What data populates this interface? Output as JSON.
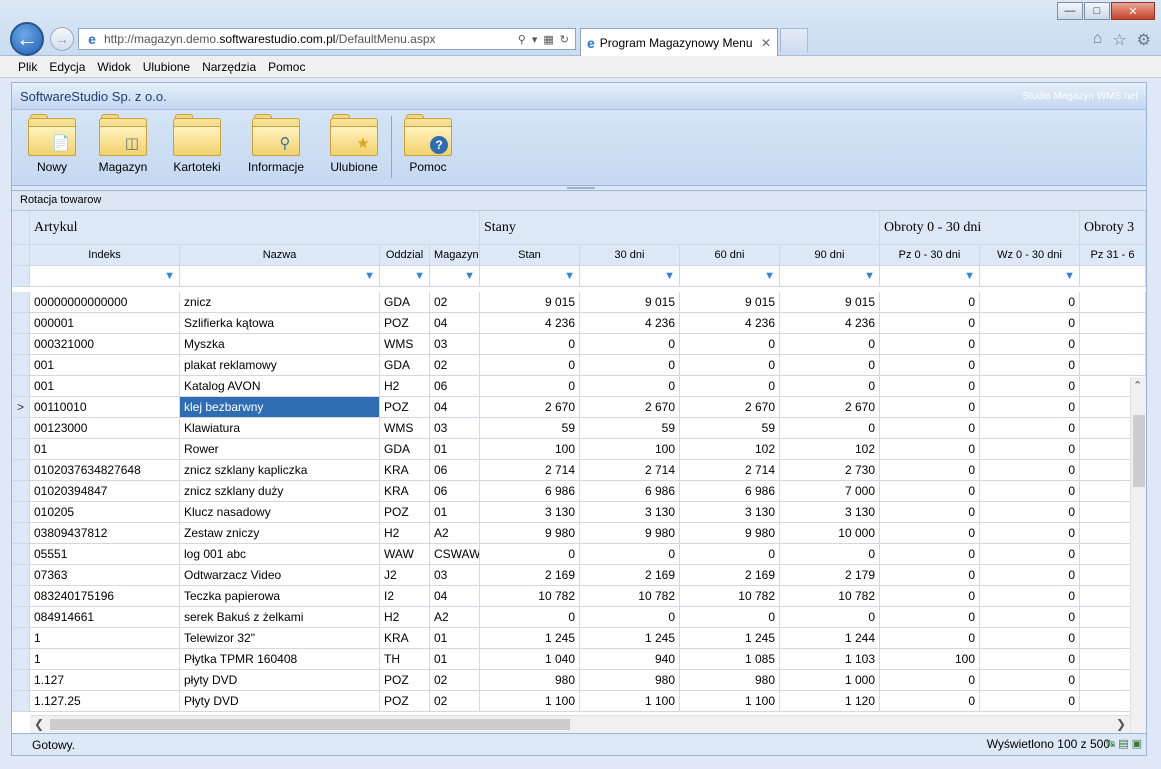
{
  "browser": {
    "url_prefix": "http://magazyn.demo.",
    "url_host": "softwarestudio.com.pl",
    "url_path": "/DefaultMenu.aspx",
    "tab_title": "Program Magazynowy Menu",
    "tab_close": "✕",
    "back": "←",
    "forward": "→"
  },
  "menu": [
    "Plik",
    "Edycja",
    "Widok",
    "Ulubione",
    "Narzędzia",
    "Pomoc"
  ],
  "app": {
    "company": "SoftwareStudio Sp. z o.o.",
    "product": "Studio Magazyn WMS.net",
    "toolbar": [
      {
        "label": "Nowy",
        "icon": "new-document-icon"
      },
      {
        "label": "Magazyn",
        "icon": "database-icon"
      },
      {
        "label": "Kartoteki",
        "icon": "folder-icon"
      },
      {
        "label": "Informacje",
        "icon": "search-icon"
      },
      {
        "label": "Ulubione",
        "icon": "star-icon"
      },
      {
        "label": "Pomoc",
        "icon": "help-icon"
      }
    ],
    "section_title": "Rotacja towarow"
  },
  "grid": {
    "bands": [
      "Artykul",
      "Stany",
      "Obroty 0 - 30 dni",
      "Obroty 3"
    ],
    "columns": [
      "Indeks",
      "Nazwa",
      "Oddzial",
      "Magazyn",
      "Stan",
      "30 dni",
      "60 dni",
      "90 dni",
      "Pz 0 - 30 dni",
      "Wz 0 - 30 dni",
      "Pz 31 - 6"
    ],
    "selected_marker": ">",
    "rows": [
      [
        "00000000000000",
        "znicz",
        "GDA",
        "02",
        "9 015",
        "9 015",
        "9 015",
        "9 015",
        "0",
        "0"
      ],
      [
        "000001",
        "Szlifierka kątowa",
        "POZ",
        "04",
        "4 236",
        "4 236",
        "4 236",
        "4 236",
        "0",
        "0"
      ],
      [
        "000321000",
        "Myszka",
        "WMS",
        "03",
        "0",
        "0",
        "0",
        "0",
        "0",
        "0"
      ],
      [
        "001",
        "plakat reklamowy",
        "GDA",
        "02",
        "0",
        "0",
        "0",
        "0",
        "0",
        "0"
      ],
      [
        "001",
        "Katalog AVON",
        "H2",
        "06",
        "0",
        "0",
        "0",
        "0",
        "0",
        "0"
      ],
      [
        "00110010",
        "klej bezbarwny",
        "POZ",
        "04",
        "2 670",
        "2 670",
        "2 670",
        "2 670",
        "0",
        "0"
      ],
      [
        "00123000",
        "Klawiatura",
        "WMS",
        "03",
        "59",
        "59",
        "59",
        "0",
        "0",
        "0"
      ],
      [
        "01",
        "Rower",
        "GDA",
        "01",
        "100",
        "100",
        "102",
        "102",
        "0",
        "0"
      ],
      [
        "0102037634827648",
        "znicz szklany kapliczka",
        "KRA",
        "06",
        "2 714",
        "2 714",
        "2 714",
        "2 730",
        "0",
        "0"
      ],
      [
        "01020394847",
        "znicz szklany duży",
        "KRA",
        "06",
        "6 986",
        "6 986",
        "6 986",
        "7 000",
        "0",
        "0"
      ],
      [
        "010205",
        "Klucz nasadowy",
        "POZ",
        "01",
        "3 130",
        "3 130",
        "3 130",
        "3 130",
        "0",
        "0"
      ],
      [
        "03809437812",
        "Zestaw zniczy",
        "H2",
        "A2",
        "9 980",
        "9 980",
        "9 980",
        "10 000",
        "0",
        "0"
      ],
      [
        "05551",
        "log 001 abc",
        "WAW",
        "CSWAW",
        "0",
        "0",
        "0",
        "0",
        "0",
        "0"
      ],
      [
        "07363",
        "Odtwarzacz Video",
        "J2",
        "03",
        "2 169",
        "2 169",
        "2 169",
        "2 179",
        "0",
        "0"
      ],
      [
        "083240175196",
        "Teczka papierowa",
        "I2",
        "04",
        "10 782",
        "10 782",
        "10 782",
        "10 782",
        "0",
        "0"
      ],
      [
        "084914661",
        "serek Bakuś z żelkami",
        "H2",
        "A2",
        "0",
        "0",
        "0",
        "0",
        "0",
        "0"
      ],
      [
        "1",
        "Telewizor 32\"",
        "KRA",
        "01",
        "1 245",
        "1 245",
        "1 245",
        "1 244",
        "0",
        "0"
      ],
      [
        "1",
        "Płytka TPMR 160408",
        "TH",
        "01",
        "1 040",
        "940",
        "1 085",
        "1 103",
        "100",
        "0"
      ],
      [
        "1.127",
        "płyty DVD",
        "POZ",
        "02",
        "980",
        "980",
        "980",
        "1 000",
        "0",
        "0"
      ],
      [
        "1.127.25",
        "Płyty DVD",
        "POZ",
        "02",
        "1 100",
        "1 100",
        "1 100",
        "1 120",
        "0",
        "0"
      ]
    ]
  },
  "status": {
    "left": "Gotowy.",
    "right": "Wyświetlono 100 z 500"
  }
}
